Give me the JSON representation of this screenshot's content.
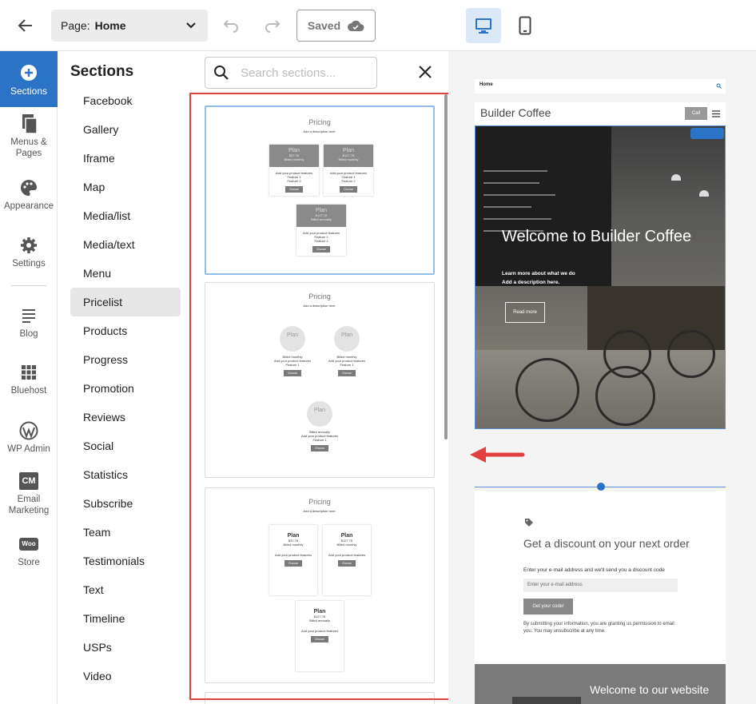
{
  "topbar": {
    "page_label": "Page:",
    "page_value": "Home",
    "saved_label": "Saved"
  },
  "leftnav": {
    "items": [
      {
        "label": "Sections",
        "icon": "plus-circle-icon"
      },
      {
        "label": "Menus &",
        "label2": "Pages",
        "icon": "pages-icon"
      },
      {
        "label": "Appearance",
        "icon": "palette-icon"
      },
      {
        "label": "Settings",
        "icon": "gear-icon"
      },
      {
        "label": "Blog",
        "icon": "blog-icon"
      },
      {
        "label": "Bluehost",
        "icon": "grid-icon"
      },
      {
        "label": "WP Admin",
        "icon": "wordpress-icon"
      },
      {
        "label": "Email",
        "label2": "Marketing",
        "icon": "cm-icon"
      },
      {
        "label": "Store",
        "icon": "woo-icon"
      }
    ],
    "cm_text": "CM",
    "woo_text": "Woo"
  },
  "sections": {
    "title": "Sections",
    "search_placeholder": "Search sections...",
    "selected": "Pricelist",
    "items": [
      "Facebook",
      "Gallery",
      "Iframe",
      "Map",
      "Media/list",
      "Media/text",
      "Menu",
      "Pricelist",
      "Products",
      "Progress",
      "Promotion",
      "Reviews",
      "Social",
      "Statistics",
      "Subscribe",
      "Team",
      "Testimonials",
      "Text",
      "Timeline",
      "USPs",
      "Video"
    ]
  },
  "previews": {
    "title": "Pricing",
    "subtitle": "Add a description here.",
    "plan": "Plan",
    "price": "$37.76",
    "price2": "$127.76",
    "billed_monthly": "Billed monthly",
    "billed_annually": "Billed annually",
    "features": "Add your product features",
    "feature1": "Feature 1",
    "feature2": "Feature 2",
    "choose": "Choose"
  },
  "site": {
    "nav_home": "Home",
    "brand": "Builder Coffee",
    "call": "Call",
    "hero_title": "Welcome to Builder Coffee",
    "hero_desc1": "Learn more about what we do",
    "hero_desc2": "Add a description here.",
    "read_more": "Read more",
    "discount_title": "Get a discount on your next order",
    "discount_sub": "Enter your e-mail address and we'll send you a discount code",
    "email_placeholder": "Enter your e-mail address",
    "get_code": "Get your code!",
    "discount_note": "By submitting your information, you are granting us permission to email you. You may unsubscribe at any time.",
    "welcome": "Welcome to our website"
  },
  "colors": {
    "accent": "#2b73c7",
    "highlight_box": "#e14040"
  }
}
